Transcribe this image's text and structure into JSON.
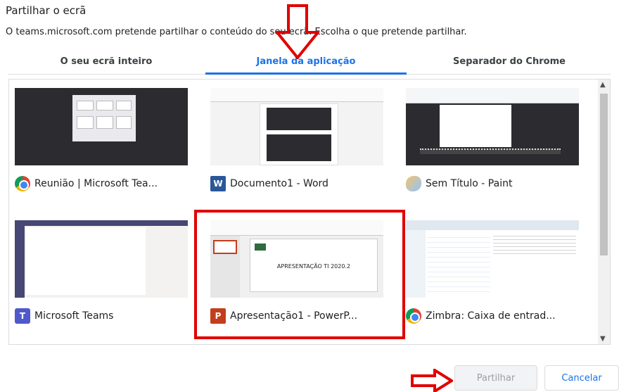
{
  "dialog": {
    "title": "Partilhar o ecrã",
    "subtitle": "O teams.microsoft.com pretende partilhar o conteúdo do seu ecrã. Escolha o que pretende partilhar."
  },
  "tabs": [
    {
      "label": "O seu ecrã inteiro",
      "active": false
    },
    {
      "label": "Janela da aplicação",
      "active": true
    },
    {
      "label": "Separador do Chrome",
      "active": false
    }
  ],
  "windows": [
    {
      "label": "Reunião | Microsoft Tea...",
      "icon": "chrome-icon"
    },
    {
      "label": "Documento1 - Word",
      "icon": "word-icon"
    },
    {
      "label": "Sem Título - Paint",
      "icon": "paint-icon"
    },
    {
      "label": "Microsoft Teams",
      "icon": "teams-icon"
    },
    {
      "label": "Apresentação1 - PowerP...",
      "icon": "powerpoint-icon"
    },
    {
      "label": "Zimbra: Caixa de entrad...",
      "icon": "chrome-icon"
    }
  ],
  "thumbnails": {
    "ppt_slide_text": "APRESENTAÇÃO TI 2020.2"
  },
  "buttons": {
    "share": "Partilhar",
    "cancel": "Cancelar"
  },
  "colors": {
    "accent": "#1a73e8",
    "annotation_red": "#e00000"
  }
}
